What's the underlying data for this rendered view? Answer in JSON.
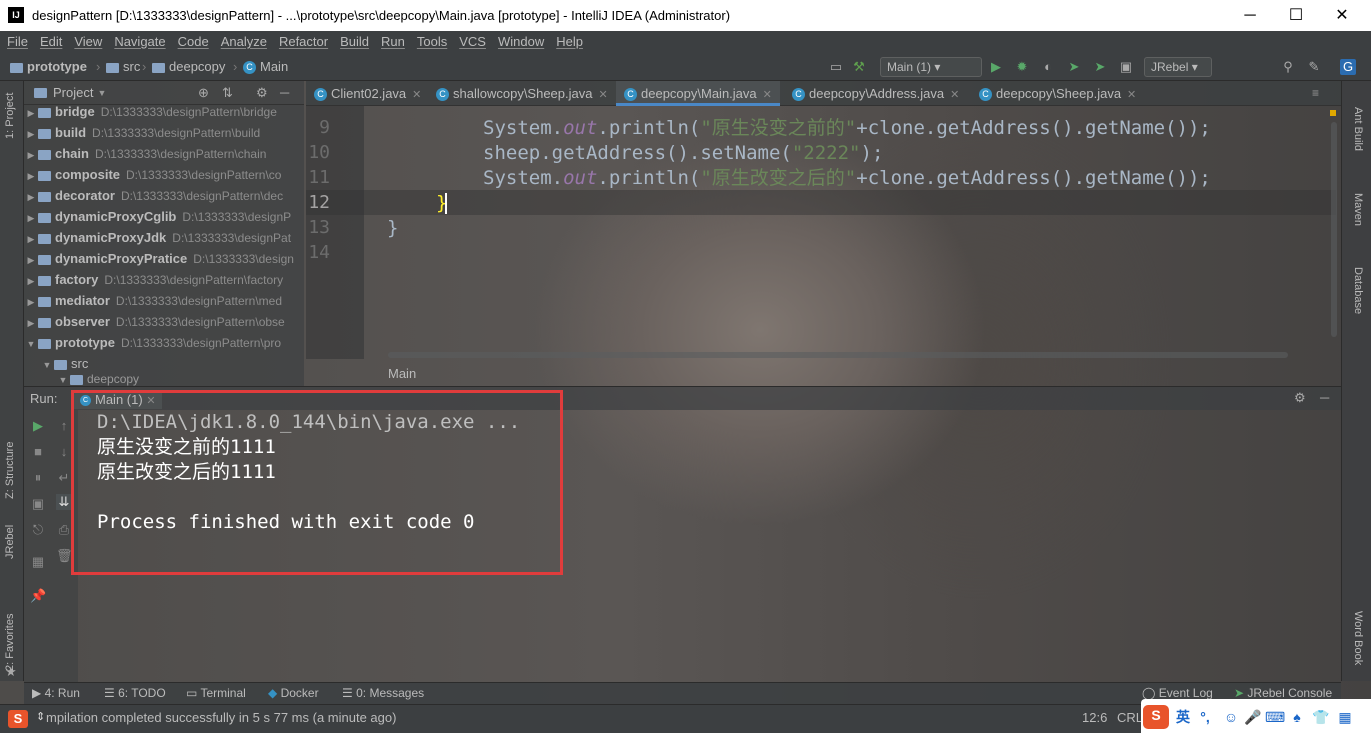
{
  "window": {
    "title": "designPattern [D:\\1333333\\designPattern] - ...\\prototype\\src\\deepcopy\\Main.java [prototype] - IntelliJ IDEA (Administrator)",
    "app_icon": "IJ",
    "minimize": "─",
    "maximize": "☐",
    "close": "✕"
  },
  "menu": [
    "File",
    "Edit",
    "View",
    "Navigate",
    "Code",
    "Analyze",
    "Refactor",
    "Build",
    "Run",
    "Tools",
    "VCS",
    "Window",
    "Help"
  ],
  "nav": {
    "crumbs": [
      "prototype",
      "src",
      "deepcopy",
      "Main"
    ],
    "run_config": "Main (1)",
    "jrebel": "JRebel"
  },
  "left_strip": {
    "project": "1: Project",
    "structure": "Z: Structure",
    "jrebel": "JRebel",
    "favorites": "2: Favorites"
  },
  "right_strip": {
    "ant": "Ant Build",
    "maven": "Maven",
    "database": "Database",
    "wordbook": "Word Book"
  },
  "project_panel": {
    "title": "Project",
    "items": [
      {
        "name": "bridge",
        "path": "D:\\1333333\\designPattern\\bridge"
      },
      {
        "name": "build",
        "path": "D:\\1333333\\designPattern\\build"
      },
      {
        "name": "chain",
        "path": "D:\\1333333\\designPattern\\chain"
      },
      {
        "name": "composite",
        "path": "D:\\1333333\\designPattern\\co"
      },
      {
        "name": "decorator",
        "path": "D:\\1333333\\designPattern\\dec"
      },
      {
        "name": "dynamicProxyCglib",
        "path": "D:\\1333333\\designP"
      },
      {
        "name": "dynamicProxyJdk",
        "path": "D:\\1333333\\designPat"
      },
      {
        "name": "dynamicProxyPratice",
        "path": "D:\\1333333\\design"
      },
      {
        "name": "factory",
        "path": "D:\\1333333\\designPattern\\factory"
      },
      {
        "name": "mediator",
        "path": "D:\\1333333\\designPattern\\med"
      },
      {
        "name": "observer",
        "path": "D:\\1333333\\designPattern\\obse"
      },
      {
        "name": "prototype",
        "path": "D:\\1333333\\designPattern\\pro"
      }
    ],
    "src": "src",
    "deepcopy": "deepcopy"
  },
  "editor": {
    "tabs": [
      "Client02.java",
      "shallowcopy\\Sheep.java",
      "deepcopy\\Main.java",
      "deepcopy\\Address.java",
      "deepcopy\\Sheep.java"
    ],
    "active_tab": 2,
    "line_numbers": [
      "9",
      "10",
      "11",
      "12",
      "13",
      "14"
    ],
    "line1": {
      "a": "System.",
      "b": "out",
      "c": ".println(",
      "d": "\"原生没变之前的\"",
      "e": "+clone.getAddress().getName());"
    },
    "line2": {
      "a": "sheep.getAddress().setName(",
      "d": "\"2222\"",
      "e": ");"
    },
    "line3": {
      "a": "System.",
      "b": "out",
      "c": ".println(",
      "d": "\"原生改变之后的\"",
      "e": "+clone.getAddress().getName());"
    },
    "line4": "}",
    "line5": "}",
    "breadcrumb": "Main"
  },
  "run": {
    "label": "Run:",
    "tab": "Main (1)",
    "output": [
      "D:\\IDEA\\jdk1.8.0_144\\bin\\java.exe ...",
      "原生没变之前的1111",
      "原生改变之后的1111",
      "",
      "Process finished with exit code 0"
    ]
  },
  "bottom_tabs": [
    "4: Run",
    "6: TODO",
    "Terminal",
    "Docker",
    "0: Messages",
    "Event Log",
    "JRebel Console"
  ],
  "status": {
    "message": "mpilation completed successfully in 5 s 77 ms (a minute ago)",
    "position": "12:6",
    "line_sep": "CRLF",
    "ime_lang": "英"
  },
  "colors": {
    "keyword": "#9876aa",
    "string": "#6a8759",
    "code": "#a9b7c6",
    "highlight_box": "#e03c3c",
    "active_tab": "#4a88c7"
  }
}
